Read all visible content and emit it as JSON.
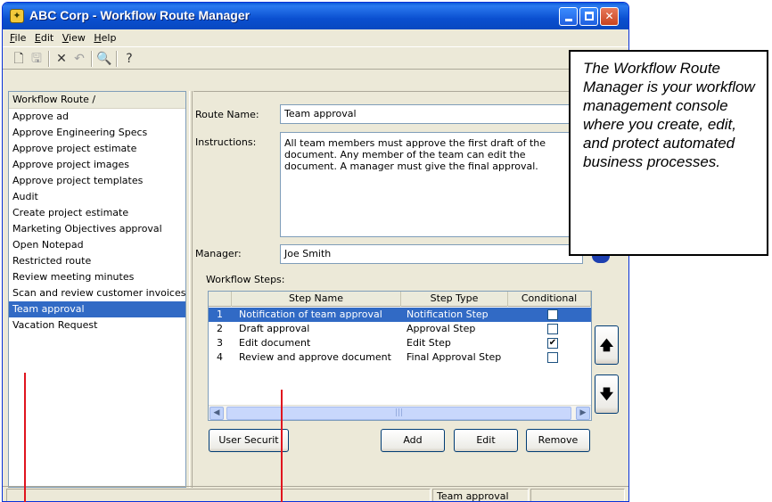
{
  "window": {
    "title": "ABC Corp - Workflow Route Manager",
    "app_icon": "wand-icon"
  },
  "menu": [
    "File",
    "Edit",
    "View",
    "Help"
  ],
  "toolbar": {
    "icons": [
      "new-document-icon",
      "save-icon",
      "delete-icon",
      "undo-icon",
      "find-icon",
      "help-icon"
    ]
  },
  "routes": {
    "header": "Workflow Route /",
    "items": [
      "Approve ad",
      "Approve Engineering Specs",
      "Approve project estimate",
      "Approve project images",
      "Approve project templates",
      "Audit",
      "Create project estimate",
      "Marketing Objectives approval",
      "Open Notepad",
      "Restricted route",
      "Review meeting minutes",
      "Scan and review customer invoices",
      "Team approval",
      "Vacation Request"
    ],
    "selected_index": 12
  },
  "form": {
    "route_name_label": "Route Name:",
    "route_name_value": "Team approval",
    "instructions_label": "Instructions:",
    "instructions_value": "All team members must approve the first draft of the document.  Any member of the team can edit the document. A manager must give the final approval.",
    "manager_label": "Manager:",
    "manager_value": "Joe Smith"
  },
  "steps": {
    "label": "Workflow Steps:",
    "columns": [
      "Step Name",
      "Step Type",
      "Conditional"
    ],
    "rows": [
      {
        "num": "1",
        "name": "Notification of team approval",
        "type": "Notification Step",
        "conditional": ""
      },
      {
        "num": "2",
        "name": "Draft approval",
        "type": "Approval Step",
        "conditional": ""
      },
      {
        "num": "3",
        "name": "Edit document",
        "type": "Edit Step",
        "conditional": "✔"
      },
      {
        "num": "4",
        "name": "Review and approve document",
        "type": "Final Approval Step",
        "conditional": ""
      }
    ],
    "selected_row": 0
  },
  "buttons": {
    "user_security": "User Securit",
    "add": "Add",
    "edit": "Edit",
    "remove": "Remove",
    "move_up": "🡅",
    "move_down": "🡇"
  },
  "status": {
    "route": "Team approval"
  },
  "callout": {
    "text": "The Workflow Route Manager is your workflow management console where you create, edit, and protect automated business processes."
  },
  "colors": {
    "selection": "#316ac5",
    "annotation_line": "#e0141e",
    "title_bar": "#0a4fd0"
  }
}
